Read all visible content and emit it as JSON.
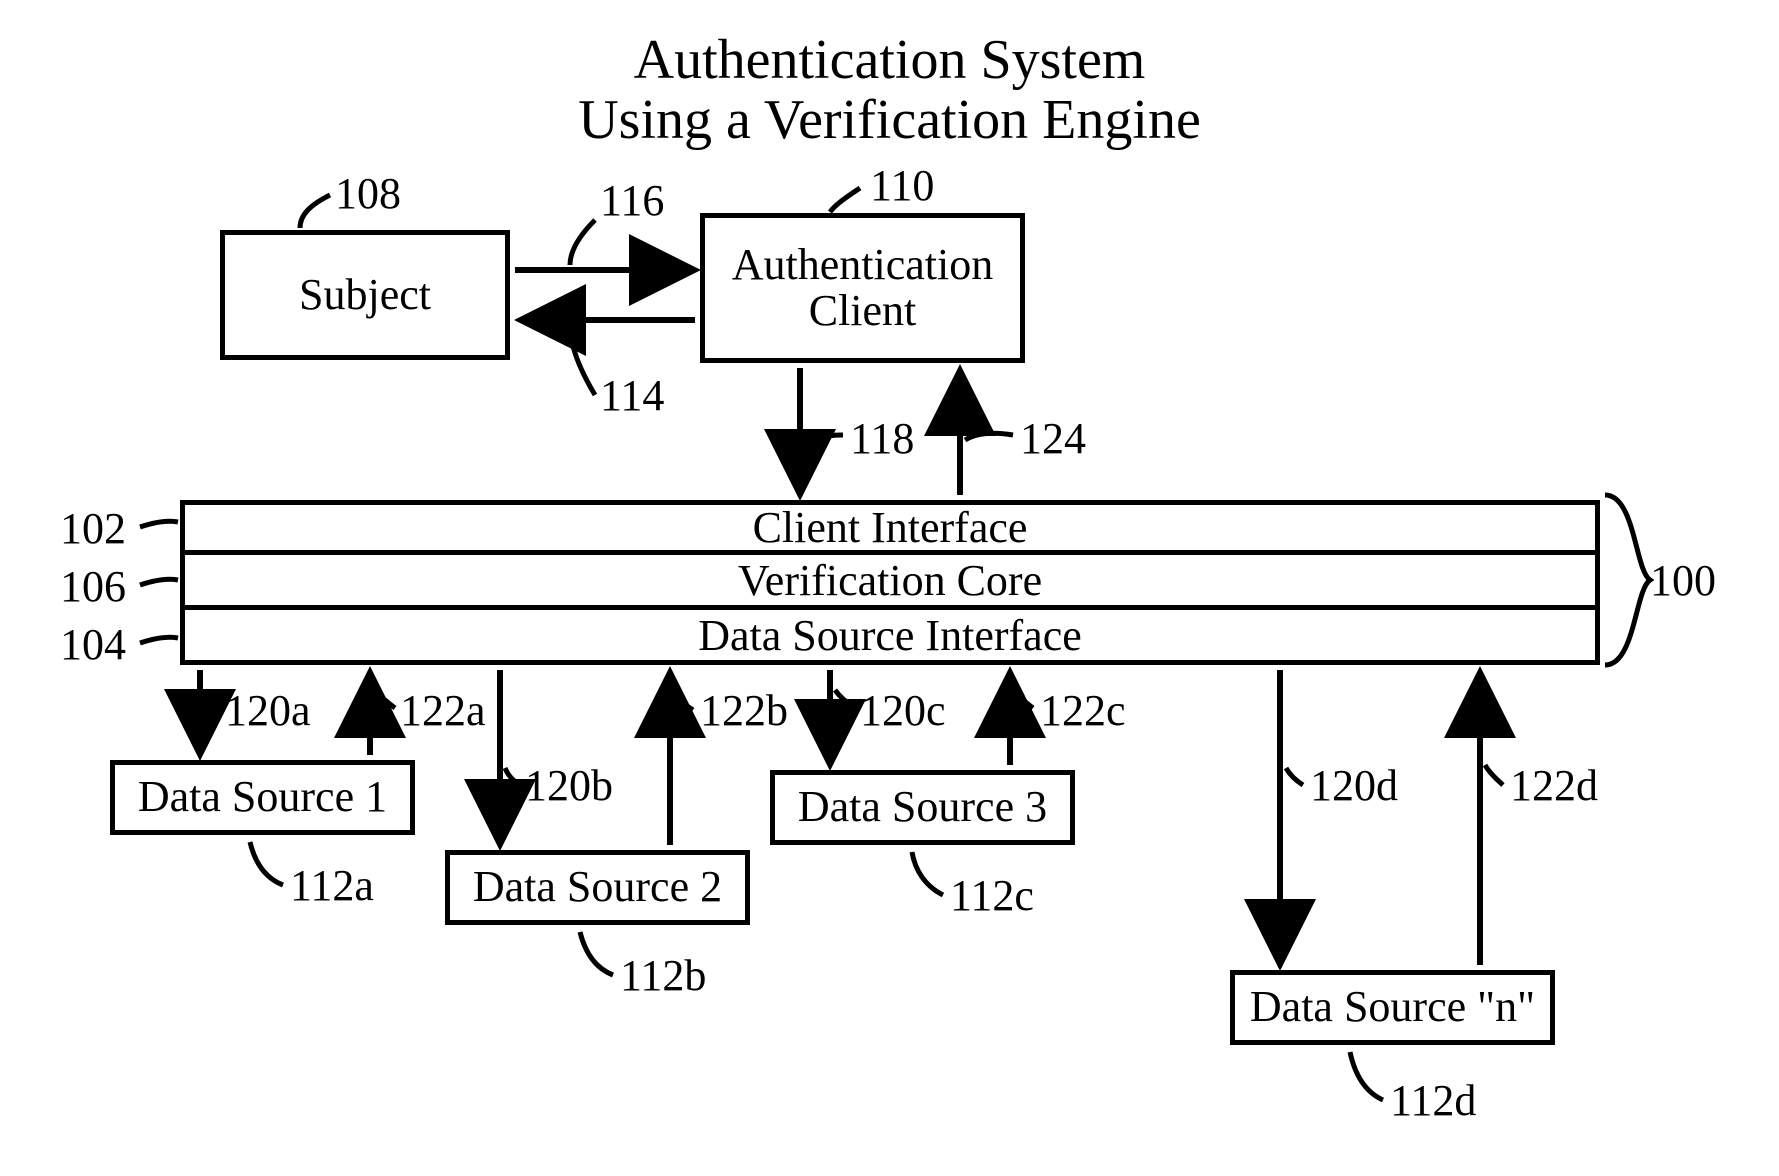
{
  "title": {
    "line1": "Authentication System",
    "line2": "Using a Verification Engine"
  },
  "boxes": {
    "subject": "Subject",
    "auth_client": "Authentication\nClient",
    "client_interface": "Client Interface",
    "verification_core": "Verification Core",
    "data_source_interface": "Data Source Interface",
    "ds1": "Data Source 1",
    "ds2": "Data Source 2",
    "ds3": "Data Source 3",
    "dsn": "Data Source \"n\""
  },
  "labels": {
    "l108": "108",
    "l116": "116",
    "l110": "110",
    "l114": "114",
    "l118": "118",
    "l124": "124",
    "l102": "102",
    "l106": "106",
    "l104": "104",
    "l100": "100",
    "l120a": "120a",
    "l122a": "122a",
    "l120b": "120b",
    "l122b": "122b",
    "l120c": "120c",
    "l122c": "122c",
    "l120d": "120d",
    "l122d": "122d",
    "l112a": "112a",
    "l112b": "112b",
    "l112c": "112c",
    "l112d": "112d"
  }
}
